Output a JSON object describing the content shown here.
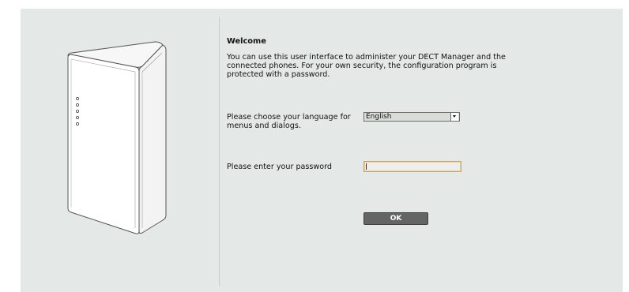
{
  "welcome": {
    "title": "Welcome",
    "intro": "You can use this user interface to administer your DECT Manager and the connected phones. For your own security, the configuration program is protected with a password."
  },
  "language": {
    "label": "Please choose your language for menus and dialogs.",
    "selected": "English"
  },
  "password": {
    "label": "Please enter your password",
    "value": ""
  },
  "actions": {
    "ok_label": "OK"
  },
  "device": {
    "icon": "dect-manager-base-station-icon",
    "led_count": 5
  },
  "colors": {
    "panel_bg": "#e4e9e7",
    "button_bg": "#646464",
    "input_border": "#c9a56a"
  }
}
